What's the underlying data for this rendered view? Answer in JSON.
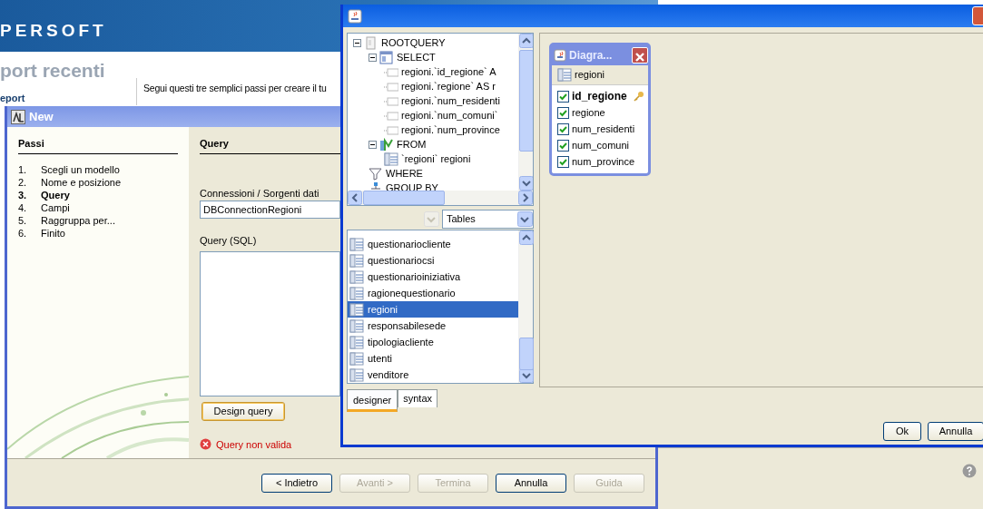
{
  "background_page": {
    "brand": "PERSOFT",
    "heading": "port recenti",
    "link": "eport",
    "intro": "Segui questi tre semplici passi per creare il tu"
  },
  "wizard": {
    "title": "New",
    "steps_heading": "Passi",
    "steps": [
      {
        "number": "1.",
        "label": "Scegli un modello",
        "selected": false
      },
      {
        "number": "2.",
        "label": "Nome e posizione",
        "selected": false
      },
      {
        "number": "3.",
        "label": "Query",
        "selected": true
      },
      {
        "number": "4.",
        "label": "Campi",
        "selected": false
      },
      {
        "number": "5.",
        "label": "Raggruppa per...",
        "selected": false
      },
      {
        "number": "6.",
        "label": "Finito",
        "selected": false
      }
    ],
    "section_title": "Query",
    "connection_label": "Connessioni / Sorgenti dati",
    "connection_value": "DBConnectionRegioni",
    "query_label": "Query (SQL)",
    "design_button": "Design query",
    "error": "Query non valida",
    "buttons": [
      {
        "label": "< Indietro",
        "disabled": false
      },
      {
        "label": "Avanti >",
        "disabled": true
      },
      {
        "label": "Termina",
        "disabled": true
      },
      {
        "label": "Annulla",
        "disabled": false
      },
      {
        "label": "Guida",
        "disabled": true
      }
    ]
  },
  "query_designer": {
    "tree": [
      {
        "label": "ROOTQUERY",
        "kind": "root",
        "expanded": true,
        "children": [
          {
            "label": "SELECT",
            "kind": "select",
            "expanded": true,
            "children": [
              {
                "label": "regioni.`id_regione` A",
                "kind": "field"
              },
              {
                "label": "regioni.`regione` AS r",
                "kind": "field"
              },
              {
                "label": "regioni.`num_residenti",
                "kind": "field"
              },
              {
                "label": "regioni.`num_comuni`",
                "kind": "field"
              },
              {
                "label": "regioni.`num_province",
                "kind": "field"
              }
            ]
          },
          {
            "label": "FROM",
            "kind": "from",
            "expanded": true,
            "children": [
              {
                "label": "`regioni` regioni",
                "kind": "table"
              }
            ]
          },
          {
            "label": "WHERE",
            "kind": "where"
          },
          {
            "label": "GROUP BY",
            "kind": "group"
          }
        ]
      }
    ],
    "object_type": "Tables",
    "tables": [
      {
        "label": "questionariocliente",
        "selected": false
      },
      {
        "label": "questionariocsi",
        "selected": false
      },
      {
        "label": "questionarioiniziativa",
        "selected": false
      },
      {
        "label": "ragionequestionario",
        "selected": false
      },
      {
        "label": "regioni",
        "selected": true
      },
      {
        "label": "responsabilesede",
        "selected": false
      },
      {
        "label": "tipologiacliente",
        "selected": false
      },
      {
        "label": "utenti",
        "selected": false
      },
      {
        "label": "venditore",
        "selected": false
      }
    ],
    "tabs": [
      {
        "label": "designer",
        "selected": true
      },
      {
        "label": "syntax",
        "selected": false
      }
    ],
    "diagram": {
      "title": "Diagra...",
      "table": "regioni",
      "columns": [
        {
          "name": "id_regione",
          "checked": true,
          "primary_key": true
        },
        {
          "name": "regione",
          "checked": true,
          "primary_key": false
        },
        {
          "name": "num_residenti",
          "checked": true,
          "primary_key": false
        },
        {
          "name": "num_comuni",
          "checked": true,
          "primary_key": false
        },
        {
          "name": "num_province",
          "checked": true,
          "primary_key": false
        }
      ]
    },
    "buttons": [
      "Ok",
      "Annulla"
    ]
  }
}
